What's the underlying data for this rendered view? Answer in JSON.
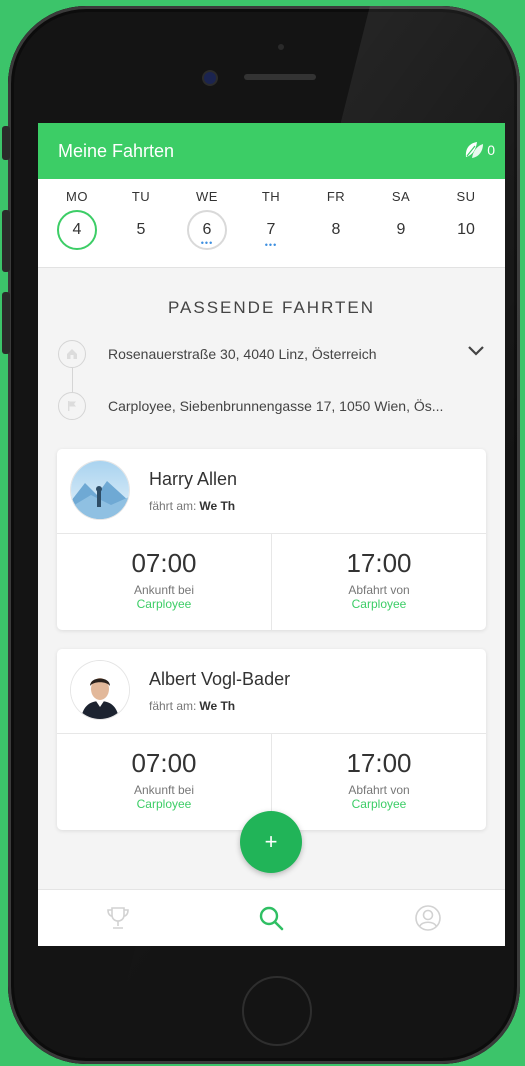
{
  "header": {
    "title": "Meine Fahrten",
    "leaf_count": "0"
  },
  "week": [
    {
      "dow": "MO",
      "num": "4",
      "state": "today",
      "dots": ""
    },
    {
      "dow": "TU",
      "num": "5",
      "state": "plain",
      "dots": ""
    },
    {
      "dow": "WE",
      "num": "6",
      "state": "selected",
      "dots": "•••"
    },
    {
      "dow": "TH",
      "num": "7",
      "state": "plain",
      "dots": "•••"
    },
    {
      "dow": "FR",
      "num": "8",
      "state": "plain",
      "dots": ""
    },
    {
      "dow": "SA",
      "num": "9",
      "state": "plain",
      "dots": ""
    },
    {
      "dow": "SU",
      "num": "10",
      "state": "plain",
      "dots": ""
    }
  ],
  "section_title": "PASSENDE FAHRTEN",
  "route": {
    "from": "Rosenauerstraße 30, 4040 Linz, Österreich",
    "to": "Carployee, Siebenbrunnengasse 17, 1050 Wien, Ös..."
  },
  "rides": [
    {
      "name": "Harry Allen",
      "days_label": "fährt am:",
      "days": "We Th",
      "arrival_time": "07:00",
      "arrival_label": "Ankunft bei",
      "arrival_place": "Carployee",
      "departure_time": "17:00",
      "departure_label": "Abfahrt von",
      "departure_place": "Carployee"
    },
    {
      "name": "Albert Vogl-Bader",
      "days_label": "fährt am:",
      "days": "We Th",
      "arrival_time": "07:00",
      "arrival_label": "Ankunft bei",
      "arrival_place": "Carployee",
      "departure_time": "17:00",
      "departure_label": "Abfahrt von",
      "departure_place": "Carployee"
    }
  ],
  "fab_symbol": "+",
  "tabs": [
    {
      "icon": "trophy-icon",
      "active": false
    },
    {
      "icon": "search-icon",
      "active": true
    },
    {
      "icon": "profile-icon",
      "active": false
    }
  ],
  "colors": {
    "accent": "#3ccd66",
    "background": "#3cc46a",
    "dots": "#3d8fe0"
  }
}
